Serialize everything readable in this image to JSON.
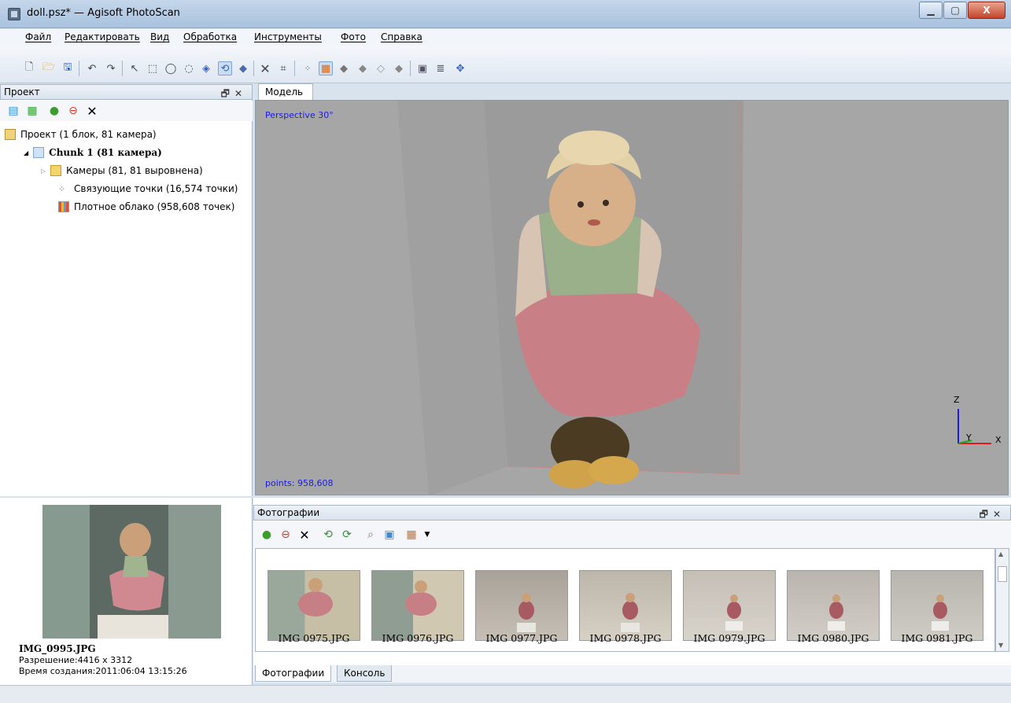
{
  "window": {
    "title": "doll.psz* — Agisoft PhotoScan",
    "close_glyph": "X",
    "minimize_glyph": "▁",
    "maximize_glyph": "▢"
  },
  "menu": [
    "Файл",
    "Редактировать",
    "Вид",
    "Обработка",
    "Инструменты",
    "Фото",
    "Справка"
  ],
  "project_panel": {
    "title": "Проект",
    "tree": {
      "root": "Проект (1 блок, 81 камера)",
      "chunk": "Chunk 1 (81 камера)",
      "cameras": "Камеры (81, 81 выровнена)",
      "tie_points": "Связующие точки (16,574 точки)",
      "dense_cloud": "Плотное облако (958,608 точек)"
    }
  },
  "viewport": {
    "tab_label": "Модель",
    "projection": "Perspective 30°",
    "points_label": "points: 958,608",
    "axis_labels": {
      "z": "Z",
      "y": "Y",
      "x": "X"
    }
  },
  "preview": {
    "filename": "IMG_0995.JPG",
    "resolution": "Разрешение:4416 x 3312",
    "created": "Время создания:2011:06:04 13:15:26"
  },
  "photos_panel": {
    "title": "Фотографии",
    "thumbnails": [
      "IMG 0975.JPG",
      "IMG 0976.JPG",
      "IMG 0977.JPG",
      "IMG 0978.JPG",
      "IMG 0979.JPG",
      "IMG 0980.JPG",
      "IMG 0981.JPG"
    ],
    "tabs": [
      "Фотографии",
      "Консоль"
    ]
  },
  "colors": {
    "accent_blue": "#1a1ae6",
    "doll_pink": "#c97f86",
    "wall_gray": "#a6a6a6"
  }
}
